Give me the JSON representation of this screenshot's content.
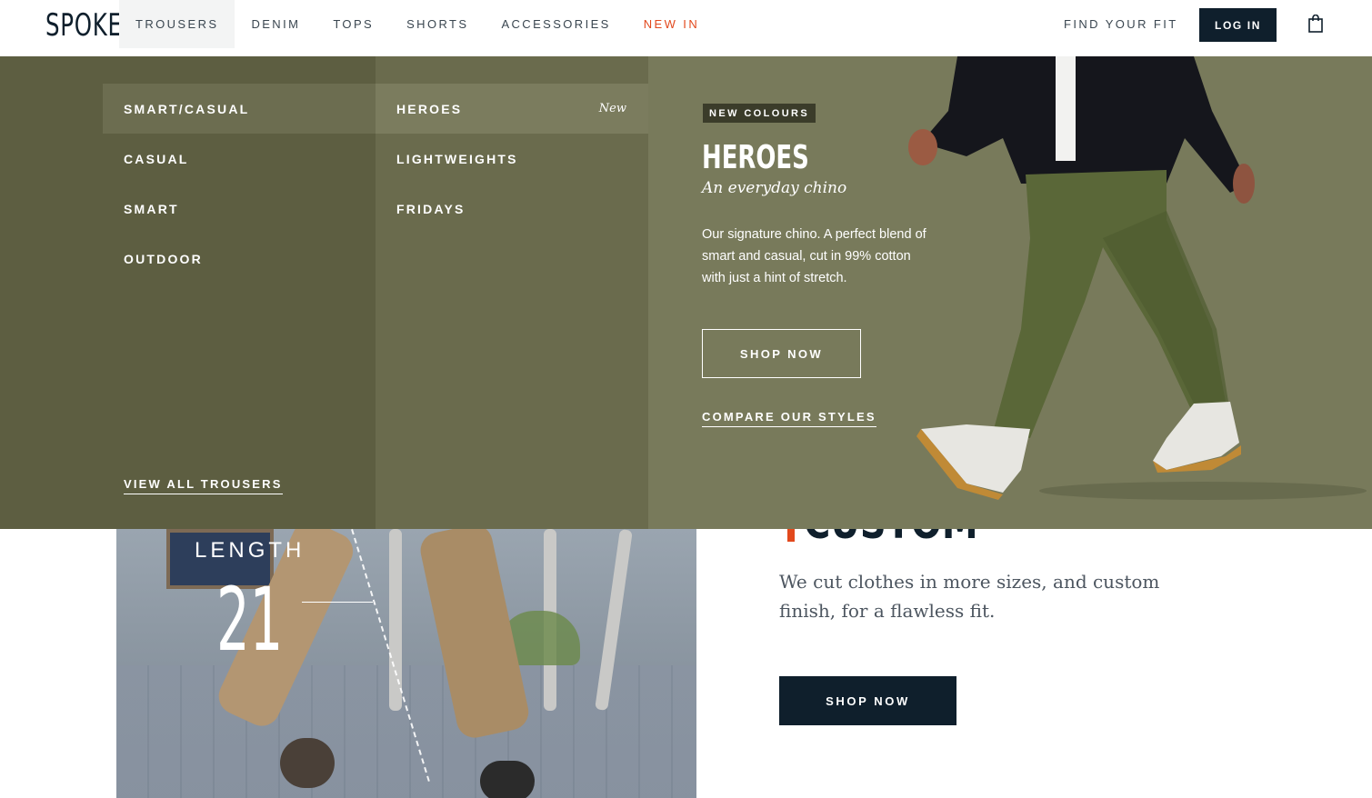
{
  "brand": {
    "logo": "SPOKE"
  },
  "nav": {
    "items": [
      {
        "label": "TROUSERS"
      },
      {
        "label": "DENIM"
      },
      {
        "label": "TOPS"
      },
      {
        "label": "SHORTS"
      },
      {
        "label": "ACCESSORIES"
      },
      {
        "label": "NEW IN"
      }
    ],
    "find_fit": "FIND YOUR FIT",
    "login": "LOG IN",
    "bag_icon": "shopping-bag-icon"
  },
  "mega_menu": {
    "categories": [
      {
        "label": "SMART/CASUAL"
      },
      {
        "label": "CASUAL"
      },
      {
        "label": "SMART"
      },
      {
        "label": "OUTDOOR"
      }
    ],
    "styles": [
      {
        "label": "HEROES",
        "tag": "New"
      },
      {
        "label": "LIGHTWEIGHTS"
      },
      {
        "label": "FRIDAYS"
      }
    ],
    "view_all": "VIEW ALL TROUSERS",
    "feature": {
      "badge": "NEW COLOURS",
      "title": "HEROES",
      "subtitle": "An everyday chino",
      "description": "Our signature chino. A perfect blend of smart and casual, cut in 99% cotton with just a hint of stretch.",
      "shop_now": "SHOP NOW",
      "compare": "COMPARE OUR STYLES"
    }
  },
  "page": {
    "video": {
      "length_label": "LENGTH",
      "length_value": "21"
    },
    "custom_fit": {
      "title": "CUSTOM FIT",
      "text": "We cut clothes in more sizes, and custom finish, for a flawless fit.",
      "button": "SHOP NOW"
    }
  },
  "colors": {
    "navy": "#0f1f2c",
    "accent_orange": "#e2491d",
    "menu_dark": "#5d5e41",
    "menu_mid": "#6a6b4d",
    "feature_bg": "#787a5b"
  }
}
